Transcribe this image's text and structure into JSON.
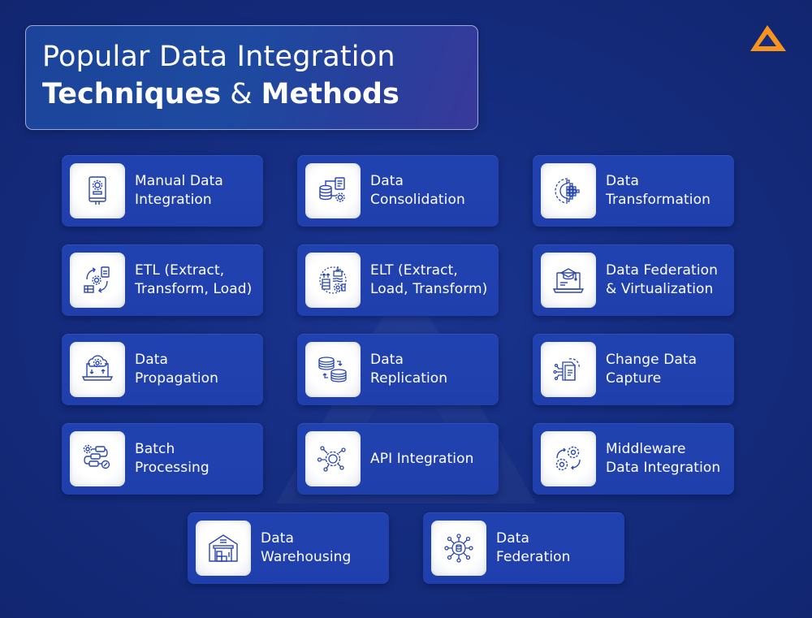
{
  "header": {
    "title_line1": "Popular Data Integration",
    "title_line2_part1": "Techniques",
    "title_line2_amp": "&",
    "title_line2_part2": "Methods"
  },
  "logo": {
    "icon": "triangle-logo-icon",
    "color": "#f7941d"
  },
  "colors": {
    "background": "#152d80",
    "card": "#2042b0",
    "icon_stroke": "#2a47b0",
    "text": "#ffffff"
  },
  "techniques": [
    {
      "label": "Manual Data\nIntegration",
      "icon": "manual-book-gear-icon"
    },
    {
      "label": "Data\nConsolidation",
      "icon": "database-document-gear-icon"
    },
    {
      "label": "Data\nTransformation",
      "icon": "gear-pixel-transform-icon"
    },
    {
      "label": "ETL (Extract,\nTransform, Load)",
      "icon": "etl-cycle-icon"
    },
    {
      "label": "ELT (Extract,\nLoad, Transform)",
      "icon": "elt-cycle-icon"
    },
    {
      "label": "Data Federation\n& Virtualization",
      "icon": "laptop-graduation-cap-icon"
    },
    {
      "label": "Data\nPropagation",
      "icon": "laptop-cloud-gear-icon"
    },
    {
      "label": "Data\nReplication",
      "icon": "database-replication-icon"
    },
    {
      "label": "Change Data\nCapture",
      "icon": "document-gear-nodes-icon"
    },
    {
      "label": "Batch\nProcessing",
      "icon": "batch-pipeline-icon"
    },
    {
      "label": "API Integration",
      "icon": "api-gear-network-icon"
    },
    {
      "label": "Middleware\nData Integration",
      "icon": "gears-arrows-icon"
    },
    {
      "label": "Data\nWarehousing",
      "icon": "warehouse-icon"
    },
    {
      "label": "Data\nFederation",
      "icon": "database-network-icon"
    }
  ]
}
